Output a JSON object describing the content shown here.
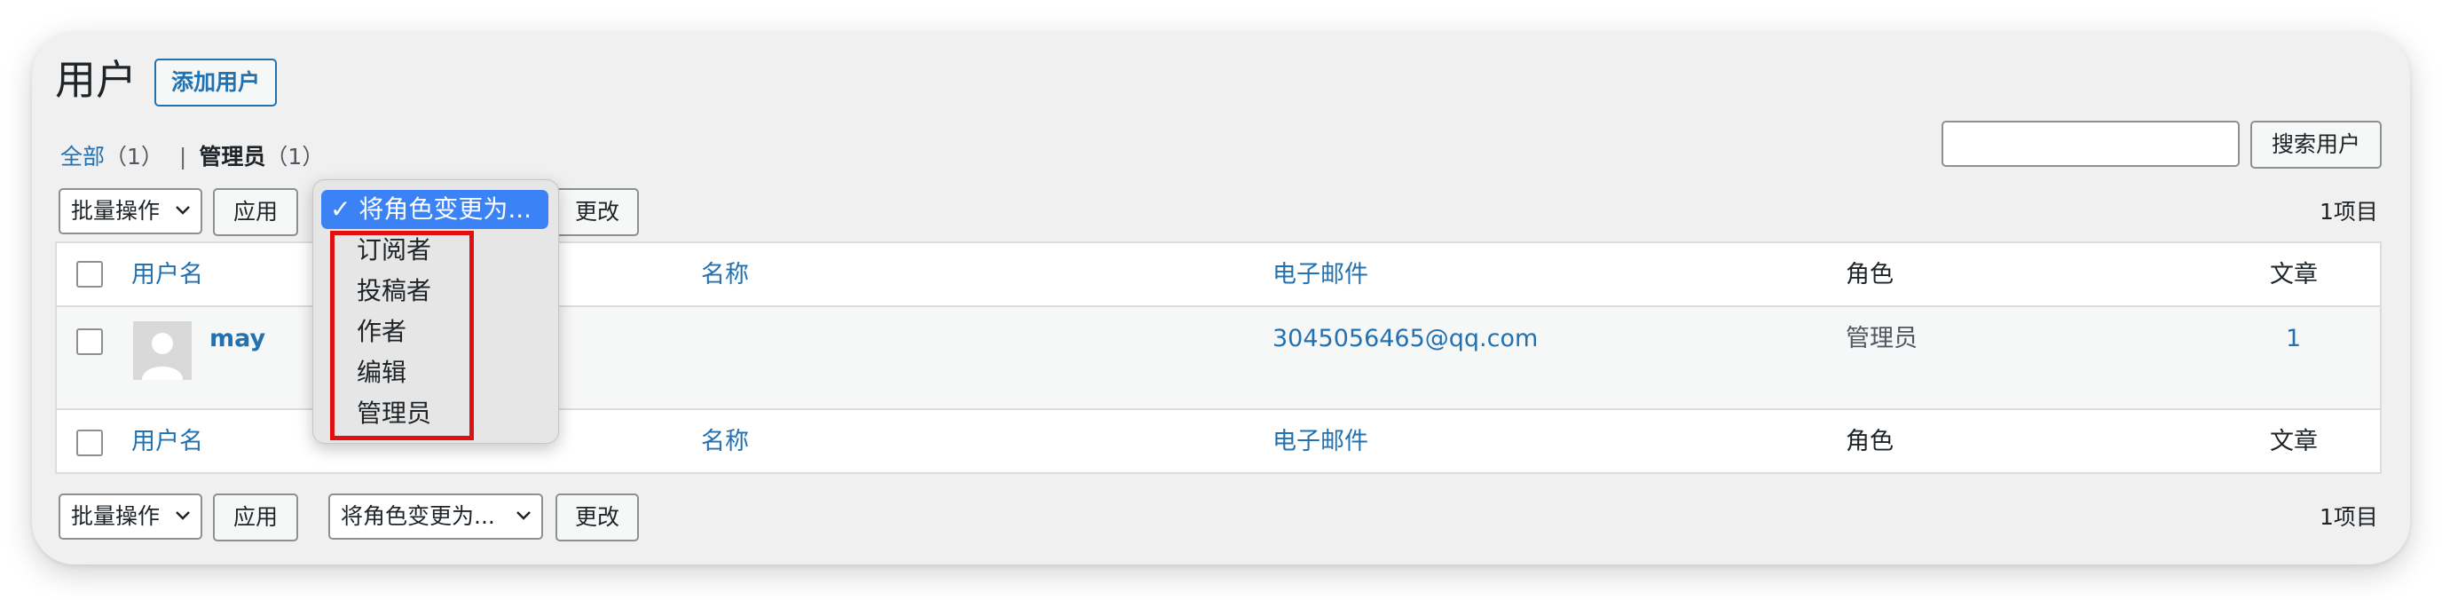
{
  "page": {
    "title": "用户",
    "add_button": "添加用户"
  },
  "views": {
    "all": {
      "label": "全部",
      "count": "（1）"
    },
    "separator": "|",
    "admin": {
      "label": "管理员",
      "count": "（1）"
    }
  },
  "search": {
    "placeholder": "",
    "button": "搜索用户"
  },
  "top_nav": {
    "bulk_actions": "批量操作",
    "apply": "应用",
    "change": "更改",
    "items_count": "1项目"
  },
  "bottom_nav": {
    "bulk_actions": "批量操作",
    "apply": "应用",
    "role_select": "将角色变更为...",
    "change": "更改",
    "items_count": "1项目"
  },
  "table": {
    "columns": [
      "用户名",
      "名称",
      "电子邮件",
      "角色",
      "文章"
    ],
    "rows": [
      {
        "username": "may",
        "name": "",
        "email": "3045056465@qq.com",
        "role": "管理员",
        "posts": "1"
      }
    ]
  },
  "role_dropdown": {
    "selected": "✓ 将角色变更为...",
    "options": [
      "订阅者",
      "投稿者",
      "作者",
      "编辑",
      "管理员"
    ]
  },
  "colors": {
    "link": "#2271b1",
    "highlight_border": "#e01010",
    "dropdown_selected": "#3b82f6"
  }
}
